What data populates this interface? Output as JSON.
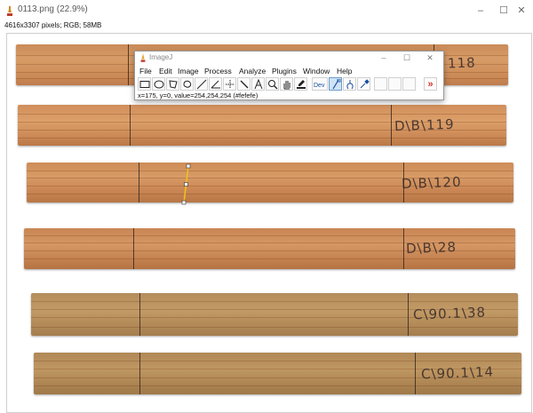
{
  "window": {
    "title": "0113.png (22.9%)",
    "info": "4616x3307 pixels; RGB; 58MB",
    "controls": {
      "minimize": "–",
      "maximize": "☐",
      "close": "✕"
    }
  },
  "strip_labels": [
    {
      "text": "118"
    },
    {
      "text": "D\\B\\119"
    },
    {
      "text": "D\\B\\120"
    },
    {
      "text": "D\\B\\28"
    },
    {
      "text": "C\\90.1\\38"
    },
    {
      "text": "C\\90.1\\14"
    }
  ],
  "imagej": {
    "title": "ImageJ",
    "controls": {
      "minimize": "–",
      "maximize": "☐",
      "close": "✕"
    },
    "menu": [
      "File",
      "Edit",
      "Image",
      "Process",
      "Analyze",
      "Plugins",
      "Window",
      "Help"
    ],
    "tools": [
      {
        "name": "rectangle-tool-icon",
        "glyph": "rect"
      },
      {
        "name": "oval-tool-icon",
        "glyph": "oval"
      },
      {
        "name": "polygon-tool-icon",
        "glyph": "poly"
      },
      {
        "name": "freehand-tool-icon",
        "glyph": "free"
      },
      {
        "name": "straight-line-tool-icon",
        "glyph": "line"
      },
      {
        "name": "angle-tool-icon",
        "glyph": "angle"
      },
      {
        "name": "point-tool-icon",
        "glyph": "point"
      },
      {
        "name": "wand-tool-icon",
        "glyph": "wand"
      },
      {
        "name": "text-tool-icon",
        "glyph": "A"
      },
      {
        "name": "magnifier-tool-icon",
        "glyph": "mag"
      },
      {
        "name": "hand-tool-icon",
        "glyph": "hand"
      },
      {
        "name": "color-picker-tool-icon",
        "glyph": "picker"
      },
      {
        "name": "developer-menu-icon",
        "glyph": "Dev"
      },
      {
        "name": "segmented-line-tool-icon",
        "glyph": "seg"
      },
      {
        "name": "brush-tool-icon",
        "glyph": "brush"
      },
      {
        "name": "dropper-tool-icon",
        "glyph": "dropper"
      },
      {
        "name": "empty-slot-1",
        "glyph": ""
      },
      {
        "name": "empty-slot-2",
        "glyph": ""
      },
      {
        "name": "empty-slot-3",
        "glyph": ""
      },
      {
        "name": "more-tools-icon",
        "glyph": "»"
      }
    ],
    "status": "x=175, y=0, value=254,254,254 (#fefefe)"
  },
  "colors": {
    "accent_red": "#d0312d",
    "selection_yellow": "#f2c21b",
    "active_tool_bg": "#cfe3f6"
  }
}
